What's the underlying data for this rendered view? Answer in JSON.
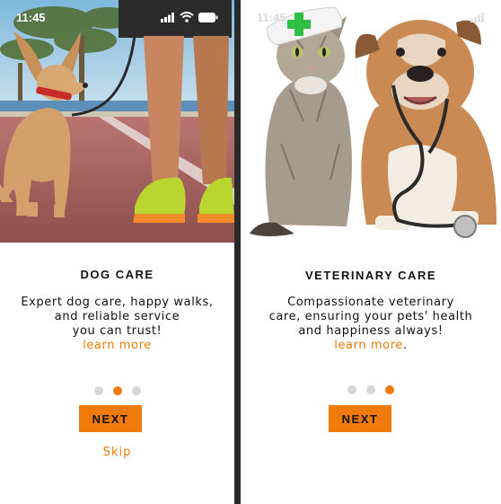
{
  "screens": [
    {
      "status_time": "11:45",
      "title": "DOG CARE",
      "body_lines": [
        "Expert dog care, happy walks,",
        "and reliable service",
        "you can trust!"
      ],
      "learn_more": "learn more",
      "page_total": 3,
      "page_current": 2,
      "next_label": "NEXT",
      "skip_label": "Skip"
    },
    {
      "status_time": "11:45",
      "title": "VETERINARY CARE",
      "body_lines": [
        "Compassionate veterinary",
        "care, ensuring your pets' health",
        "and happiness always!"
      ],
      "learn_more": "learn more",
      "learn_more_suffix": ".",
      "page_total": 3,
      "page_current": 3,
      "next_label": "NEXT"
    }
  ],
  "colors": {
    "accent": "#f07a0a",
    "dot_inactive": "#d6d6d6",
    "text": "#111111"
  },
  "icons": [
    "signal-icon",
    "wifi-icon",
    "battery-icon",
    "nurse-cap-icon",
    "stethoscope-icon",
    "dog-leash-icon"
  ]
}
